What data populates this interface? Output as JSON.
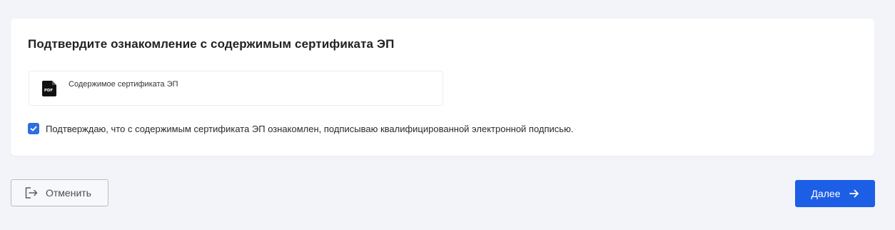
{
  "card": {
    "title": "Подтвердите ознакомление с содержимым сертификата ЭП",
    "file": {
      "icon": "pdf-file-icon",
      "icon_text": "PDF",
      "name": "Содержимое сертификата ЭП"
    },
    "confirm": {
      "checked": true,
      "text": "Подтверждаю, что с содержимым сертификата ЭП ознакомлен, подписываю квалифицированной электронной подписью."
    }
  },
  "actions": {
    "cancel": {
      "icon": "logout-icon",
      "label": "Отменить"
    },
    "next": {
      "label": "Далее",
      "icon": "arrow-right-icon"
    }
  },
  "colors": {
    "accent": "#1d5ee6",
    "checkbox": "#2d6ee0",
    "background": "#f3f4f9"
  }
}
